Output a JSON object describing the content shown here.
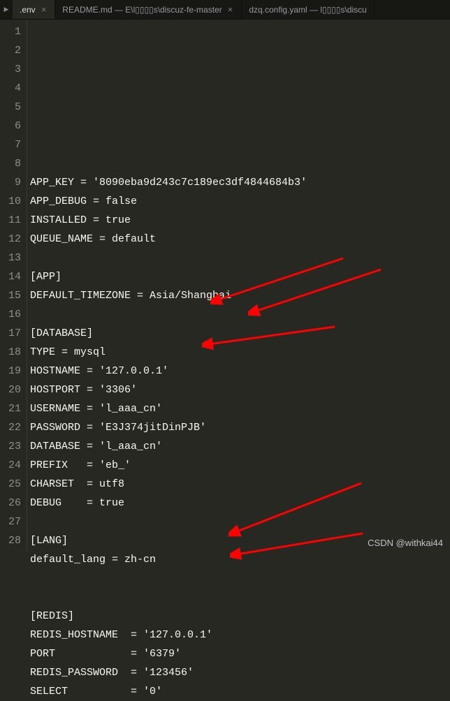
{
  "tabs": [
    {
      "label": ".env",
      "active": true
    },
    {
      "label": "README.md — E\\l▯▯▯▯s\\discuz-fe-master",
      "active": false
    },
    {
      "label": "dzq.config.yaml — l▯▯▯▯s\\discu",
      "active": false
    }
  ],
  "lines": [
    "APP_KEY = '8090eba9d243c7c189ec3df4844684b3'",
    "APP_DEBUG = false",
    "INSTALLED = true",
    "QUEUE_NAME = default",
    "",
    "[APP]",
    "DEFAULT_TIMEZONE = Asia/Shanghai",
    "",
    "[DATABASE]",
    "TYPE = mysql",
    "HOSTNAME = '127.0.0.1'",
    "HOSTPORT = '3306'",
    "USERNAME = 'l_aaa_cn'",
    "PASSWORD = 'E3J374jitDinPJB'",
    "DATABASE = 'l_aaa_cn'",
    "PREFIX   = 'eb_'",
    "CHARSET  = utf8",
    "DEBUG    = true",
    "",
    "[LANG]",
    "default_lang = zh-cn",
    "",
    "",
    "[REDIS]",
    "REDIS_HOSTNAME  = '127.0.0.1'",
    "PORT            = '6379'",
    "REDIS_PASSWORD  = '123456'",
    "SELECT          = '0'"
  ],
  "watermark": "CSDN @withkai44"
}
